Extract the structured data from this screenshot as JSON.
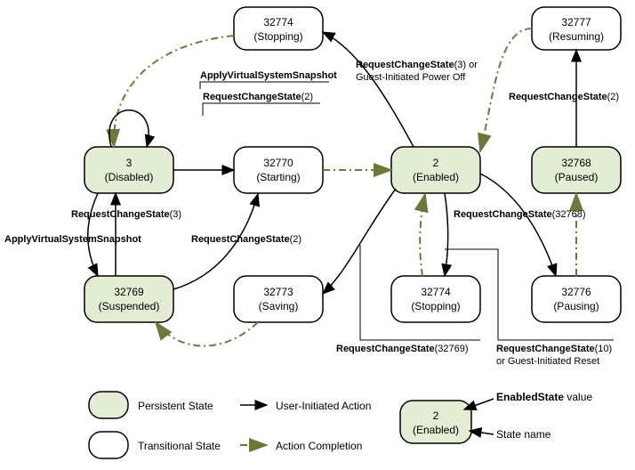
{
  "states": {
    "disabled": {
      "value": "3",
      "name": "(Disabled)"
    },
    "starting": {
      "value": "32770",
      "name": "(Starting)"
    },
    "enabled": {
      "value": "2",
      "name": "(Enabled)"
    },
    "paused": {
      "value": "32768",
      "name": "(Paused)"
    },
    "suspended": {
      "value": "32769",
      "name": "(Suspended)"
    },
    "saving": {
      "value": "32773",
      "name": "(Saving)"
    },
    "stoppingA": {
      "value": "32774",
      "name": "(Stopping)"
    },
    "stoppingB": {
      "value": "32774",
      "name": "(Stopping)"
    },
    "pausing": {
      "value": "32776",
      "name": "(Pausing)"
    },
    "resuming": {
      "value": "32777",
      "name": "(Resuming)"
    }
  },
  "labels": {
    "applySnap1": {
      "b": "ApplyVirtualSystemSnapshot",
      "r": ""
    },
    "reqChange2a": {
      "b": "RequestChangeState",
      "r": "(2)"
    },
    "reqChange3b": {
      "b": "RequestChangeState",
      "r": "(3)"
    },
    "applySnap2": {
      "b": "ApplyVirtualSystemSnapshot",
      "r": ""
    },
    "reqChange2b": {
      "b": "RequestChangeState",
      "r": "(2)"
    },
    "reqChange3or": {
      "b": "RequestChangeState",
      "r": "(3) or"
    },
    "guestOff": {
      "b": "",
      "r": "Guest-Initiated Power Off"
    },
    "reqChange2c": {
      "b": "RequestChangeState",
      "r": "(2)"
    },
    "req32768": {
      "b": "RequestChangeState",
      "r": "(32768)"
    },
    "req32769": {
      "b": "RequestChangeState",
      "r": "(32769)"
    },
    "req10": {
      "b": "RequestChangeState",
      "r": "(10)"
    },
    "guestReset": {
      "b": "",
      "r": "or Guest-Initiated Reset"
    }
  },
  "legend": {
    "persistent": "Persistent State",
    "transitional": "Transitional State",
    "userAction": "User-Initiated Action",
    "actionComp": "Action Completion",
    "enVal": {
      "b": "EnabledState",
      "r": " value"
    },
    "stName": "State name",
    "sample": {
      "value": "2",
      "name": "(Enabled)"
    }
  }
}
